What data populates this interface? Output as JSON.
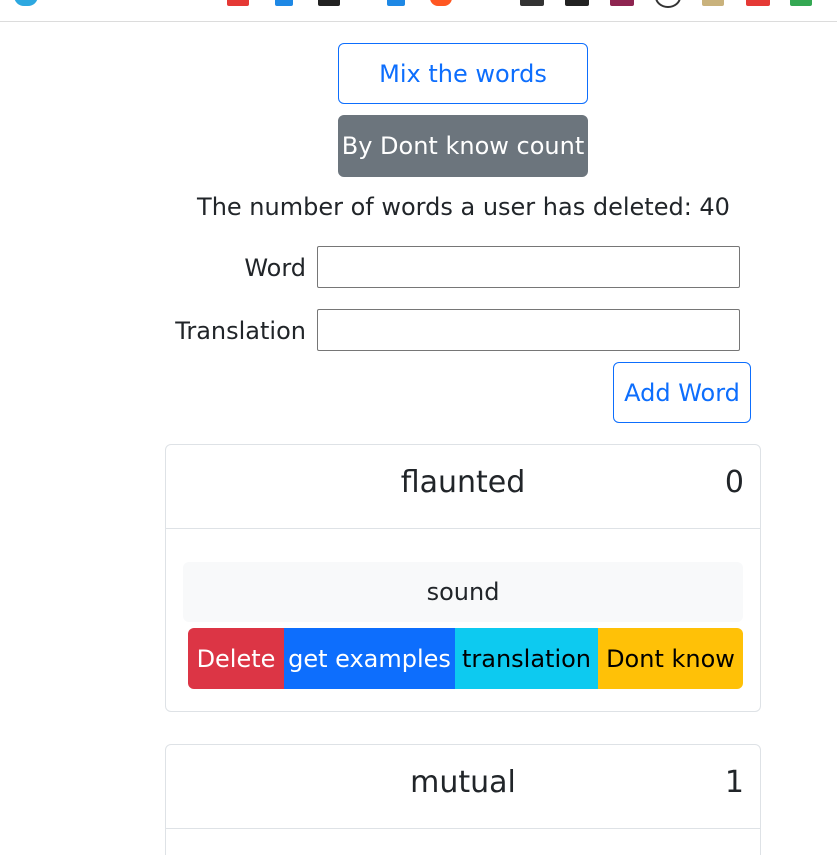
{
  "controls": {
    "mix_label": "Mix the words",
    "sort_label": "By Dont know count"
  },
  "stats": {
    "deleted_text": "The number of words a user has deleted: 40"
  },
  "form": {
    "word_label": "Word",
    "word_value": "",
    "translation_label": "Translation",
    "translation_value": "",
    "add_label": "Add Word"
  },
  "cards": [
    {
      "word": "flaunted",
      "count": "0",
      "translation": "sound",
      "actions": {
        "delete": "Delete",
        "examples": "get examples",
        "translation": "translation",
        "dont_know": "Dont know"
      }
    },
    {
      "word": "mutual",
      "count": "1"
    }
  ],
  "colors": {
    "primary": "#0d6efd",
    "secondary": "#6c757d",
    "danger": "#dc3545",
    "info": "#0dcaf0",
    "warning": "#ffc107"
  }
}
